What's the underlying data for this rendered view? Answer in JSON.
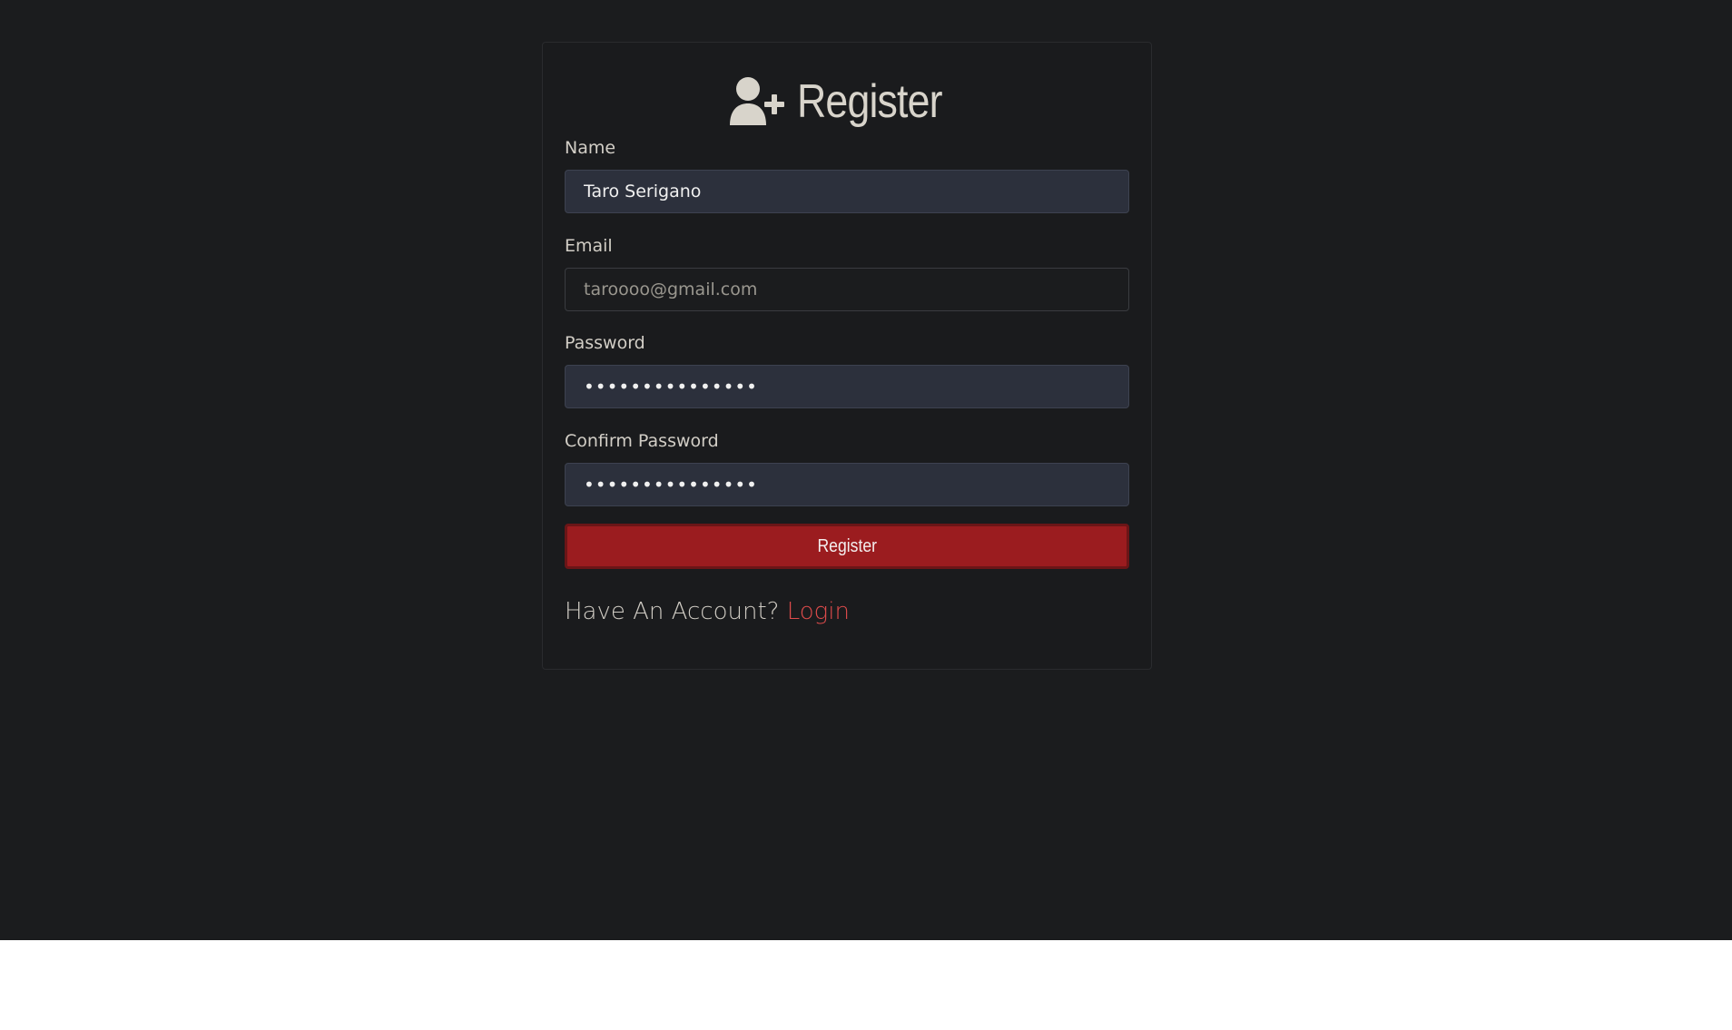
{
  "page": {
    "title": "Register",
    "title_icon": "user-plus-icon"
  },
  "form": {
    "name": {
      "label": "Name",
      "value": "Taro Serigano"
    },
    "email": {
      "label": "Email",
      "value": "taroooo@gmail.com"
    },
    "password": {
      "label": "Password",
      "value": "•••••••••••••••"
    },
    "confirm_password": {
      "label": "Confirm Password",
      "value": "•••••••••••••••"
    },
    "submit_label": "Register"
  },
  "footer": {
    "prompt": "Have An Account?",
    "link_label": "Login"
  },
  "colors": {
    "background": "#1b1c1e",
    "input_fill": "#2c303c",
    "button": "#9b1c1f",
    "link": "#dc4b4b"
  }
}
